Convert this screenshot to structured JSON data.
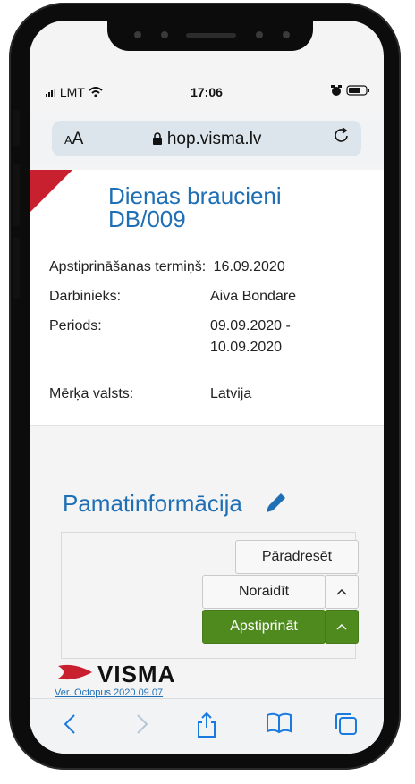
{
  "status_bar": {
    "signal": "LMT",
    "time": "17:06"
  },
  "browser": {
    "text_size_label": "AA",
    "url": "hop.visma.lv"
  },
  "document": {
    "title_line1": "Dienas braucieni",
    "title_line2": "DB/009",
    "fields": {
      "deadline_label": "Apstiprināšanas termiņš:",
      "deadline_value": "16.09.2020",
      "employee_label": "Darbinieks:",
      "employee_value": "Aiva Bondare",
      "period_label": "Periods:",
      "period_value_line1": "09.09.2020 -",
      "period_value_line2": "10.09.2020",
      "country_label": "Mērķa valsts:",
      "country_value": "Latvija"
    }
  },
  "section": {
    "title": "Pamatinformācija"
  },
  "actions": {
    "forward_label": "Pāradresēt",
    "reject_label": "Noraidīt",
    "approve_label": "Apstiprināt"
  },
  "footer": {
    "brand": "VISMA",
    "version": "Ver. Octopus 2020.09.07"
  },
  "colors": {
    "accent_blue": "#1f6fb5",
    "brand_red": "#c8202f",
    "approve_green": "#4f8a1f"
  }
}
